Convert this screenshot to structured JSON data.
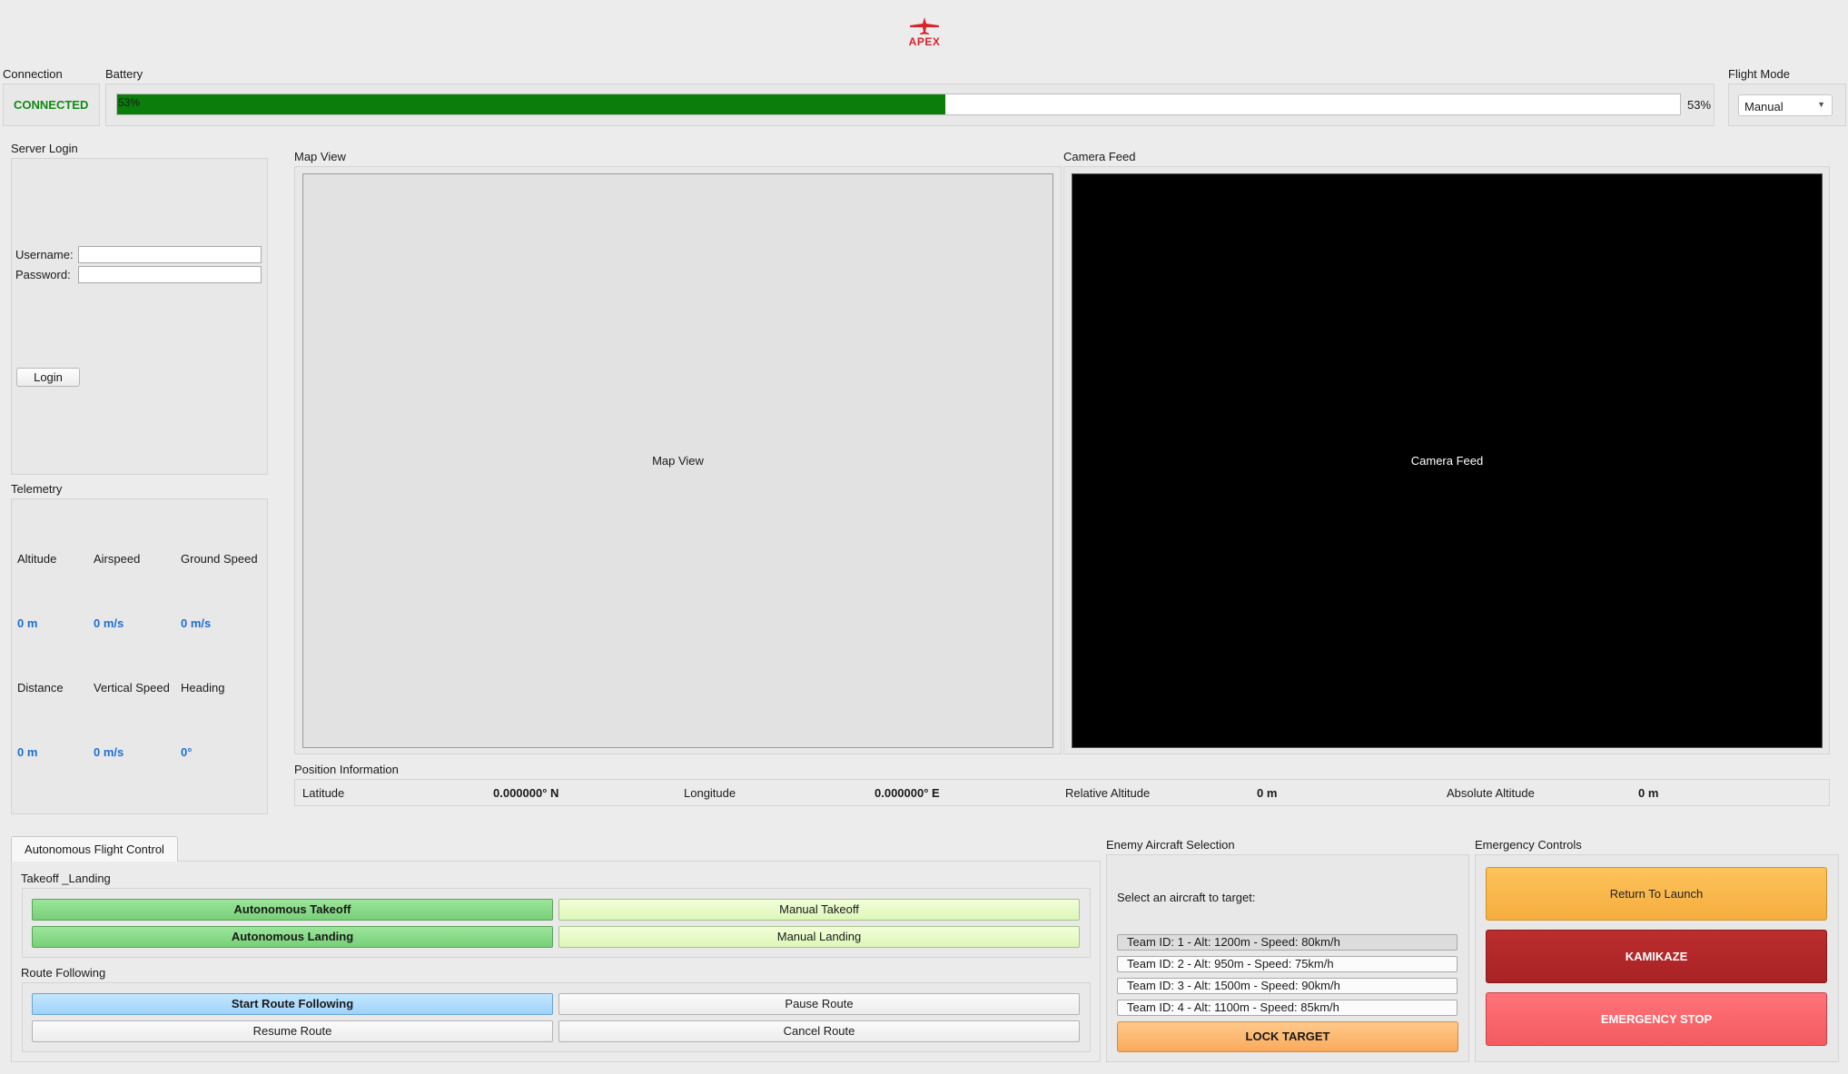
{
  "app": {
    "logo_text": "APEX"
  },
  "connection": {
    "title": "Connection",
    "status": "CONNECTED"
  },
  "battery": {
    "title": "Battery",
    "percent": 53,
    "inner_label": "53%",
    "label": "53%"
  },
  "flight_mode": {
    "title": "Flight Mode",
    "selected": "Manual"
  },
  "server_login": {
    "title": "Server Login",
    "username_label": "Username:",
    "password_label": "Password:",
    "username_value": "",
    "password_value": "",
    "login_button": "Login"
  },
  "telemetry": {
    "title": "Telemetry",
    "fields": [
      {
        "label": "Altitude",
        "value": "0 m"
      },
      {
        "label": "Airspeed",
        "value": "0 m/s"
      },
      {
        "label": "Ground Speed",
        "value": "0 m/s"
      },
      {
        "label": "Distance",
        "value": "0 m"
      },
      {
        "label": "Vertical Speed",
        "value": "0 m/s"
      },
      {
        "label": "Heading",
        "value": "0°"
      }
    ]
  },
  "map_view": {
    "title": "Map View",
    "placeholder": "Map View"
  },
  "camera_feed": {
    "title": "Camera Feed",
    "placeholder": "Camera Feed"
  },
  "position_info": {
    "title": "Position Information",
    "latitude_label": "Latitude",
    "latitude_value": "0.000000° N",
    "longitude_label": "Longitude",
    "longitude_value": "0.000000° E",
    "relative_altitude_label": "Relative Altitude",
    "relative_altitude_value": "0 m",
    "absolute_altitude_label": "Absolute Altitude",
    "absolute_altitude_value": "0 m"
  },
  "autonomous": {
    "tab_label": "Autonomous Flight Control",
    "takeoff_landing_title": "Takeoff _Landing",
    "autonomous_takeoff": "Autonomous Takeoff",
    "manual_takeoff": "Manual Takeoff",
    "autonomous_landing": "Autonomous Landing",
    "manual_landing": "Manual Landing",
    "route_title": "Route Following",
    "start_route": "Start Route Following",
    "pause_route": "Pause Route",
    "resume_route": "Resume Route",
    "cancel_route": "Cancel Route"
  },
  "enemy": {
    "title": "Enemy Aircraft Selection",
    "prompt": "Select an aircraft to target:",
    "aircraft": [
      "Team ID: 1 - Alt: 1200m - Speed: 80km/h",
      "Team ID: 2 - Alt: 950m - Speed: 75km/h",
      "Team ID: 3 - Alt: 1500m - Speed: 90km/h",
      "Team ID: 4 - Alt: 1100m - Speed: 85km/h"
    ],
    "selected_index": 0,
    "lock_button": "LOCK TARGET"
  },
  "emergency": {
    "title": "Emergency Controls",
    "return_to_launch": "Return To Launch",
    "kamikaze": "KAMIKAZE",
    "emergency_stop": "EMERGENCY STOP"
  },
  "colors": {
    "brand_red": "#d8232a",
    "connected_green": "#128a12",
    "battery_green": "#0b7d0b",
    "telemetry_value_blue": "#1f6fcf"
  }
}
